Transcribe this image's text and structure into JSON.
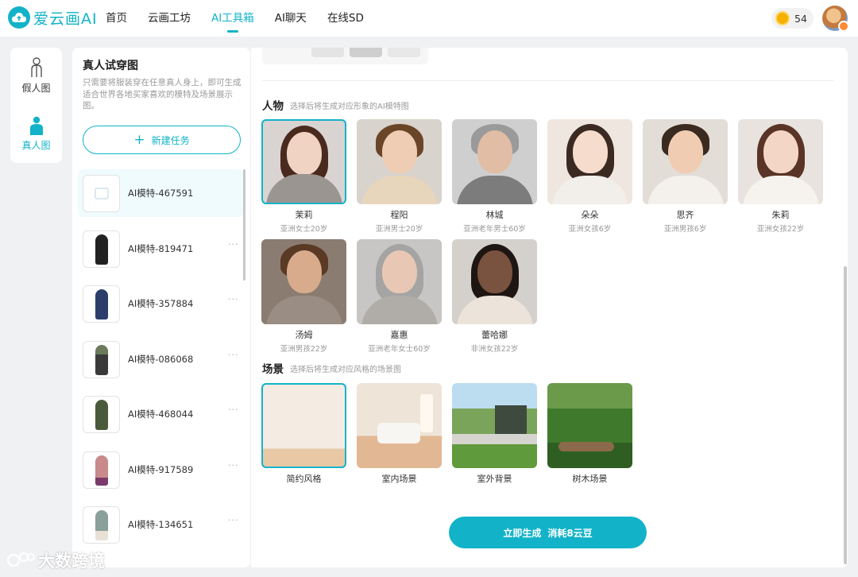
{
  "header": {
    "brand": "爱云画AI",
    "nav": [
      "首页",
      "云画工坊",
      "AI工具箱",
      "AI聊天",
      "在线SD"
    ],
    "active_nav": 2,
    "coins": "54"
  },
  "modes": [
    {
      "label": "假人图",
      "icon": "mannequin-icon"
    },
    {
      "label": "真人图",
      "icon": "person-icon"
    }
  ],
  "task_panel": {
    "title": "真人试穿图",
    "description": "只需要将服装穿在任意真人身上，即可生成适合世界各地买家喜欢的模特及场景展示图。",
    "new_task": "新建任务",
    "tasks": [
      {
        "name": "AI模特-467591",
        "more": ""
      },
      {
        "name": "AI模特-819471",
        "more": "···"
      },
      {
        "name": "AI模特-357884",
        "more": "···"
      },
      {
        "name": "AI模特-086068",
        "more": "···"
      },
      {
        "name": "AI模特-468044",
        "more": "···"
      },
      {
        "name": "AI模特-917589",
        "more": "···"
      },
      {
        "name": "AI模特-134651",
        "more": "···"
      }
    ]
  },
  "models_section": {
    "title": "人物",
    "subtitle": "选择后将生成对应形象的AI模特图",
    "items": [
      {
        "name": "茉莉",
        "desc": "亚洲女士20岁"
      },
      {
        "name": "程阳",
        "desc": "亚洲男士20岁"
      },
      {
        "name": "林城",
        "desc": "亚洲老年男士60岁"
      },
      {
        "name": "朵朵",
        "desc": "亚洲女孩6岁"
      },
      {
        "name": "思齐",
        "desc": "亚洲男孩6岁"
      },
      {
        "name": "朱莉",
        "desc": "亚洲女孩22岁"
      },
      {
        "name": "汤姆",
        "desc": "亚洲男孩22岁"
      },
      {
        "name": "嘉惠",
        "desc": "亚洲老年女士60岁"
      },
      {
        "name": "蕾哈娜",
        "desc": "非洲女孩22岁"
      }
    ]
  },
  "scenes_section": {
    "title": "场景",
    "subtitle": "选择后将生成对应风格的场景图",
    "items": [
      {
        "name": "简约风格"
      },
      {
        "name": "室内场景"
      },
      {
        "name": "室外背景"
      },
      {
        "name": "树木场景"
      }
    ]
  },
  "generate": {
    "label": "立即生成",
    "cost": "消耗8云豆"
  },
  "watermark": "大数跨境",
  "colors": {
    "accent": "#12b3c8",
    "selected_bg": "#effbfd"
  }
}
